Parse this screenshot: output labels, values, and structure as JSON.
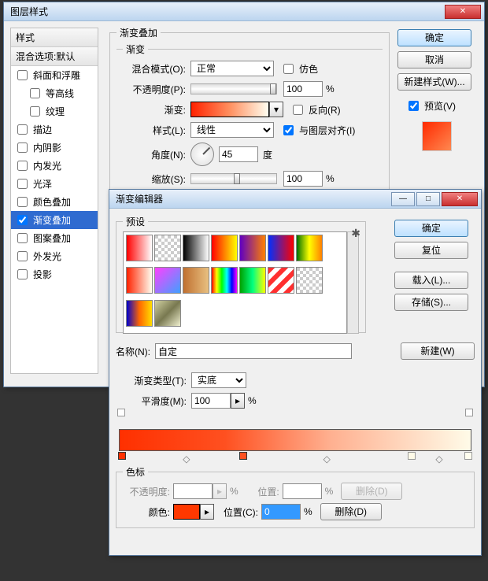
{
  "layerStyle": {
    "title": "图层样式",
    "stylesHeader": "样式",
    "blendOptionsHeader": "混合选项:默认",
    "effects": [
      {
        "label": "斜面和浮雕",
        "checked": false
      },
      {
        "label": "等高线",
        "checked": false,
        "indent": true
      },
      {
        "label": "纹理",
        "checked": false,
        "indent": true
      },
      {
        "label": "描边",
        "checked": false
      },
      {
        "label": "内阴影",
        "checked": false
      },
      {
        "label": "内发光",
        "checked": false
      },
      {
        "label": "光泽",
        "checked": false
      },
      {
        "label": "颜色叠加",
        "checked": false
      },
      {
        "label": "渐变叠加",
        "checked": true,
        "selected": true
      },
      {
        "label": "图案叠加",
        "checked": false
      },
      {
        "label": "外发光",
        "checked": false
      },
      {
        "label": "投影",
        "checked": false
      }
    ],
    "panel": {
      "groupTitle": "渐变叠加",
      "subGroup": "渐变",
      "blendModeLabel": "混合模式(O):",
      "blendMode": "正常",
      "ditherLabel": "仿色",
      "opacityLabel": "不透明度(P):",
      "opacity": "100",
      "pct": "%",
      "gradientLabel": "渐变:",
      "reverseLabel": "反向(R)",
      "styleLabel": "样式(L):",
      "style": "线性",
      "alignLabel": "与图层对齐(I)",
      "angleLabel": "角度(N):",
      "angle": "45",
      "degree": "度",
      "scaleLabel": "缩放(S):",
      "scale": "100"
    },
    "buttons": {
      "ok": "确定",
      "cancel": "取消",
      "newStyle": "新建样式(W)...",
      "previewLabel": "预览(V)"
    }
  },
  "gradEditor": {
    "title": "渐变编辑器",
    "presetLabel": "预设",
    "gearIcon": "gear-icon",
    "buttons": {
      "ok": "确定",
      "reset": "复位",
      "load": "载入(L)...",
      "save": "存储(S)...",
      "new": "新建(W)",
      "delete": "删除(D)"
    },
    "nameLabel": "名称(N):",
    "name": "自定",
    "typeLabel": "渐变类型(T):",
    "type": "实底",
    "smoothLabel": "平滑度(M):",
    "smooth": "100",
    "pct": "%",
    "stopsGroup": "色标",
    "opacityLabel": "不透明度:",
    "positionLabel": "位置:",
    "colorLabel": "颜色:",
    "positionCLabel": "位置(C):",
    "positionC": "0",
    "presetGradients": [
      "linear-gradient(90deg,#ff0000,#fff)",
      "repeating-conic-gradient(#ccc 0 25%,#fff 0 50%) 0/8px 8px",
      "linear-gradient(90deg,#000,#fff)",
      "linear-gradient(90deg,#ff0000,#ff8000,#ffff00)",
      "linear-gradient(90deg,#6000c0,#ff8000)",
      "linear-gradient(90deg,#0030ff,#ff0000)",
      "linear-gradient(90deg,#007000,#ffff00,#ff8000)",
      "linear-gradient(90deg,#ff2200,#fffef0)",
      "linear-gradient(135deg,#ff40ff,#40a0ff)",
      "linear-gradient(90deg,#c07030,#e8c080)",
      "linear-gradient(90deg,#ff0000,#ffff00,#00ff00,#00ffff,#0000ff,#ff00ff)",
      "linear-gradient(90deg,#00a000,#00ff80,#ffff00)",
      "repeating-linear-gradient(135deg,#ff3030 0 6px,#fff 6px 12px)",
      "repeating-conic-gradient(#ccc 0 25%,#fff 0 50%) 0/8px 8px",
      "linear-gradient(90deg,#0000cc,#ff6600,#ffdd00)",
      "linear-gradient(135deg,#d0d0a0,#787850,#f0f0d0)"
    ]
  }
}
